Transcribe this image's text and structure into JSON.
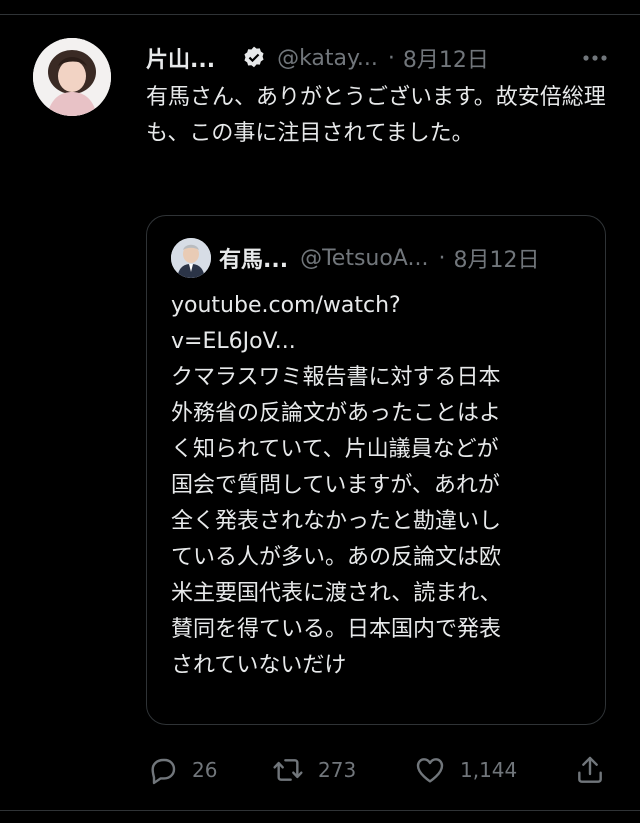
{
  "tweet": {
    "author_name": "片山...",
    "author_handle": "@katay...",
    "separator": "·",
    "date": "8月12日",
    "text": "有馬さん、ありがとうございます。故安倍総理も、この事に注目されてました。",
    "verified_icon": "verified-badge-icon",
    "more_icon": "more-options-icon"
  },
  "quote": {
    "author_name": "有馬...",
    "author_handle": "@TetsuoA...",
    "separator": "·",
    "date": "8月12日",
    "lines": [
      "youtube.com/watch?",
      "v=EL6JoV...",
      "クマラスワミ報告書に対する日本",
      "外務省の反論文があったことはよ",
      "く知られていて、片山議員などが",
      "国会で質問していますが、あれが",
      "全く発表されなかったと勘違いし",
      "ている人が多い。あの反論文は欧",
      "米主要国代表に渡され、読まれ、",
      "賛同を得ている。日本国内で発表",
      "されていないだけ"
    ]
  },
  "actions": {
    "reply_count": "26",
    "retweet_count": "273",
    "like_count": "1,144",
    "icons": [
      "reply-icon",
      "retweet-icon",
      "like-icon",
      "share-icon"
    ]
  },
  "colors": {
    "background": "#000000",
    "primary_text": "#e7e9ea",
    "secondary_text": "#71767b",
    "border": "#2f3336"
  }
}
